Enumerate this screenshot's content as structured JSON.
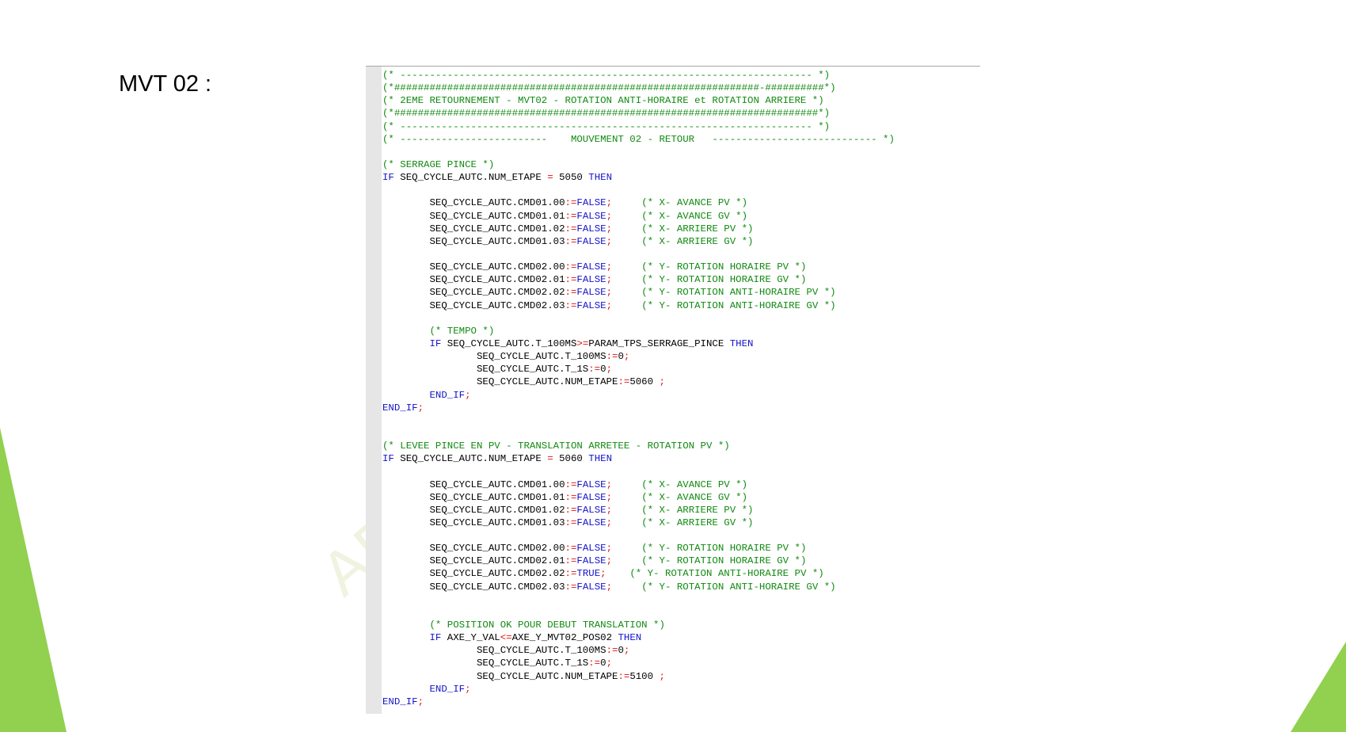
{
  "slide": {
    "title": "MVT 02 :",
    "watermark": "AE",
    "accent_color": "#92d050"
  },
  "code": {
    "colors": {
      "comment": "#118a11",
      "keyword": "#1414c8",
      "operator": "#e01010",
      "text": "#000000"
    },
    "lines": [
      [
        [
          "c",
          "(* ---------------------------------------------------------------------- *)"
        ]
      ],
      [
        [
          "c",
          "(*##############################################################-##########*)"
        ]
      ],
      [
        [
          "c",
          "(* 2EME RETOURNEMENT - MVT02 - ROTATION ANTI-HORAIRE et ROTATION ARRIERE *)"
        ]
      ],
      [
        [
          "c",
          "(*########################################################################*)"
        ]
      ],
      [
        [
          "c",
          "(* ---------------------------------------------------------------------- *)"
        ]
      ],
      [
        [
          "c",
          "(* -------------------------    MOUVEMENT 02 - RETOUR   ---------------------------- *)"
        ]
      ],
      [],
      [
        [
          "c",
          "(* SERRAGE PINCE *)"
        ]
      ],
      [
        [
          "k",
          "IF"
        ],
        [
          "t",
          " SEQ_CYCLE_AUTC.NUM_ETAPE "
        ],
        [
          "o",
          "="
        ],
        [
          "t",
          " 5050 "
        ],
        [
          "k",
          "THEN"
        ]
      ],
      [],
      [
        [
          "t",
          "        SEQ_CYCLE_AUTC.CMD01.00"
        ],
        [
          "o",
          ":="
        ],
        [
          "k",
          "FALSE"
        ],
        [
          "o",
          ";"
        ],
        [
          "t",
          "     "
        ],
        [
          "c",
          "(* X- AVANCE PV *)"
        ]
      ],
      [
        [
          "t",
          "        SEQ_CYCLE_AUTC.CMD01.01"
        ],
        [
          "o",
          ":="
        ],
        [
          "k",
          "FALSE"
        ],
        [
          "o",
          ";"
        ],
        [
          "t",
          "     "
        ],
        [
          "c",
          "(* X- AVANCE GV *)"
        ]
      ],
      [
        [
          "t",
          "        SEQ_CYCLE_AUTC.CMD01.02"
        ],
        [
          "o",
          ":="
        ],
        [
          "k",
          "FALSE"
        ],
        [
          "o",
          ";"
        ],
        [
          "t",
          "     "
        ],
        [
          "c",
          "(* X- ARRIERE PV *)"
        ]
      ],
      [
        [
          "t",
          "        SEQ_CYCLE_AUTC.CMD01.03"
        ],
        [
          "o",
          ":="
        ],
        [
          "k",
          "FALSE"
        ],
        [
          "o",
          ";"
        ],
        [
          "t",
          "     "
        ],
        [
          "c",
          "(* X- ARRIERE GV *)"
        ]
      ],
      [],
      [
        [
          "t",
          "        SEQ_CYCLE_AUTC.CMD02.00"
        ],
        [
          "o",
          ":="
        ],
        [
          "k",
          "FALSE"
        ],
        [
          "o",
          ";"
        ],
        [
          "t",
          "     "
        ],
        [
          "c",
          "(* Y- ROTATION HORAIRE PV *)"
        ]
      ],
      [
        [
          "t",
          "        SEQ_CYCLE_AUTC.CMD02.01"
        ],
        [
          "o",
          ":="
        ],
        [
          "k",
          "FALSE"
        ],
        [
          "o",
          ";"
        ],
        [
          "t",
          "     "
        ],
        [
          "c",
          "(* Y- ROTATION HORAIRE GV *)"
        ]
      ],
      [
        [
          "t",
          "        SEQ_CYCLE_AUTC.CMD02.02"
        ],
        [
          "o",
          ":="
        ],
        [
          "k",
          "FALSE"
        ],
        [
          "o",
          ";"
        ],
        [
          "t",
          "     "
        ],
        [
          "c",
          "(* Y- ROTATION ANTI-HORAIRE PV *)"
        ]
      ],
      [
        [
          "t",
          "        SEQ_CYCLE_AUTC.CMD02.03"
        ],
        [
          "o",
          ":="
        ],
        [
          "k",
          "FALSE"
        ],
        [
          "o",
          ";"
        ],
        [
          "t",
          "     "
        ],
        [
          "c",
          "(* Y- ROTATION ANTI-HORAIRE GV *)"
        ]
      ],
      [],
      [
        [
          "t",
          "        "
        ],
        [
          "c",
          "(* TEMPO *)"
        ]
      ],
      [
        [
          "t",
          "        "
        ],
        [
          "k",
          "IF"
        ],
        [
          "t",
          " SEQ_CYCLE_AUTC.T_100MS"
        ],
        [
          "o",
          ">="
        ],
        [
          "t",
          "PARAM_TPS_SERRAGE_PINCE "
        ],
        [
          "k",
          "THEN"
        ]
      ],
      [
        [
          "t",
          "                SEQ_CYCLE_AUTC.T_100MS"
        ],
        [
          "o",
          ":="
        ],
        [
          "t",
          "0"
        ],
        [
          "o",
          ";"
        ]
      ],
      [
        [
          "t",
          "                SEQ_CYCLE_AUTC.T_1S"
        ],
        [
          "o",
          ":="
        ],
        [
          "t",
          "0"
        ],
        [
          "o",
          ";"
        ]
      ],
      [
        [
          "t",
          "                SEQ_CYCLE_AUTC.NUM_ETAPE"
        ],
        [
          "o",
          ":="
        ],
        [
          "t",
          "5060 "
        ],
        [
          "o",
          ";"
        ]
      ],
      [
        [
          "t",
          "        "
        ],
        [
          "k",
          "END_IF"
        ],
        [
          "o",
          ";"
        ]
      ],
      [
        [
          "k",
          "END_IF"
        ],
        [
          "o",
          ";"
        ]
      ],
      [],
      [],
      [
        [
          "c",
          "(* LEVEE PINCE EN PV - TRANSLATION ARRETEE - ROTATION PV *)"
        ]
      ],
      [
        [
          "k",
          "IF"
        ],
        [
          "t",
          " SEQ_CYCLE_AUTC.NUM_ETAPE "
        ],
        [
          "o",
          "="
        ],
        [
          "t",
          " 5060 "
        ],
        [
          "k",
          "THEN"
        ]
      ],
      [],
      [
        [
          "t",
          "        SEQ_CYCLE_AUTC.CMD01.00"
        ],
        [
          "o",
          ":="
        ],
        [
          "k",
          "FALSE"
        ],
        [
          "o",
          ";"
        ],
        [
          "t",
          "     "
        ],
        [
          "c",
          "(* X- AVANCE PV *)"
        ]
      ],
      [
        [
          "t",
          "        SEQ_CYCLE_AUTC.CMD01.01"
        ],
        [
          "o",
          ":="
        ],
        [
          "k",
          "FALSE"
        ],
        [
          "o",
          ";"
        ],
        [
          "t",
          "     "
        ],
        [
          "c",
          "(* X- AVANCE GV *)"
        ]
      ],
      [
        [
          "t",
          "        SEQ_CYCLE_AUTC.CMD01.02"
        ],
        [
          "o",
          ":="
        ],
        [
          "k",
          "FALSE"
        ],
        [
          "o",
          ";"
        ],
        [
          "t",
          "     "
        ],
        [
          "c",
          "(* X- ARRIERE PV *)"
        ]
      ],
      [
        [
          "t",
          "        SEQ_CYCLE_AUTC.CMD01.03"
        ],
        [
          "o",
          ":="
        ],
        [
          "k",
          "FALSE"
        ],
        [
          "o",
          ";"
        ],
        [
          "t",
          "     "
        ],
        [
          "c",
          "(* X- ARRIERE GV *)"
        ]
      ],
      [],
      [
        [
          "t",
          "        SEQ_CYCLE_AUTC.CMD02.00"
        ],
        [
          "o",
          ":="
        ],
        [
          "k",
          "FALSE"
        ],
        [
          "o",
          ";"
        ],
        [
          "t",
          "     "
        ],
        [
          "c",
          "(* Y- ROTATION HORAIRE PV *)"
        ]
      ],
      [
        [
          "t",
          "        SEQ_CYCLE_AUTC.CMD02.01"
        ],
        [
          "o",
          ":="
        ],
        [
          "k",
          "FALSE"
        ],
        [
          "o",
          ";"
        ],
        [
          "t",
          "     "
        ],
        [
          "c",
          "(* Y- ROTATION HORAIRE GV *)"
        ]
      ],
      [
        [
          "t",
          "        SEQ_CYCLE_AUTC.CMD02.02"
        ],
        [
          "o",
          ":="
        ],
        [
          "k",
          "TRUE"
        ],
        [
          "o",
          ";"
        ],
        [
          "t",
          "    "
        ],
        [
          "c",
          "(* Y- ROTATION ANTI-HORAIRE PV *)"
        ]
      ],
      [
        [
          "t",
          "        SEQ_CYCLE_AUTC.CMD02.03"
        ],
        [
          "o",
          ":="
        ],
        [
          "k",
          "FALSE"
        ],
        [
          "o",
          ";"
        ],
        [
          "t",
          "     "
        ],
        [
          "c",
          "(* Y- ROTATION ANTI-HORAIRE GV *)"
        ]
      ],
      [],
      [],
      [
        [
          "t",
          "        "
        ],
        [
          "c",
          "(* POSITION OK POUR DEBUT TRANSLATION *)"
        ]
      ],
      [
        [
          "t",
          "        "
        ],
        [
          "k",
          "IF"
        ],
        [
          "t",
          " AXE_Y_VAL"
        ],
        [
          "o",
          "<="
        ],
        [
          "t",
          "AXE_Y_MVT02_POS02 "
        ],
        [
          "k",
          "THEN"
        ]
      ],
      [
        [
          "t",
          "                SEQ_CYCLE_AUTC.T_100MS"
        ],
        [
          "o",
          ":="
        ],
        [
          "t",
          "0"
        ],
        [
          "o",
          ";"
        ]
      ],
      [
        [
          "t",
          "                SEQ_CYCLE_AUTC.T_1S"
        ],
        [
          "o",
          ":="
        ],
        [
          "t",
          "0"
        ],
        [
          "o",
          ";"
        ]
      ],
      [
        [
          "t",
          "                SEQ_CYCLE_AUTC.NUM_ETAPE"
        ],
        [
          "o",
          ":="
        ],
        [
          "t",
          "5100 "
        ],
        [
          "o",
          ";"
        ]
      ],
      [
        [
          "t",
          "        "
        ],
        [
          "k",
          "END_IF"
        ],
        [
          "o",
          ";"
        ]
      ],
      [
        [
          "k",
          "END_IF"
        ],
        [
          "o",
          ";"
        ]
      ]
    ]
  }
}
